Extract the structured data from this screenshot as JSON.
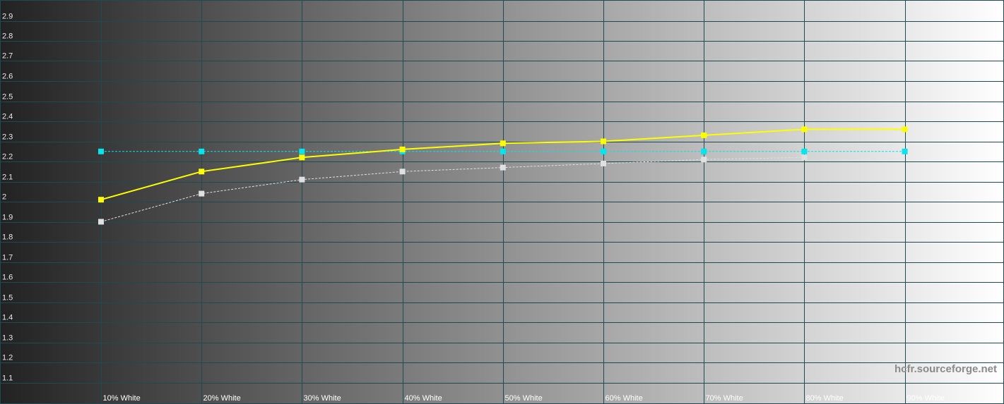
{
  "watermark": "hcfr.sourceforge.net",
  "colors": {
    "grid": "#1f4b50",
    "gradient_start": "#222222",
    "gradient_end": "#ffffff",
    "measured": "#ffff00",
    "reference": "#00e5ee",
    "previous": "#e0e0e0"
  },
  "chart_data": {
    "type": "line",
    "title": "",
    "xlabel": "",
    "ylabel": "",
    "categories": [
      "10% White",
      "20% White",
      "30% White",
      "40% White",
      "50% White",
      "60% White",
      "70% White",
      "80% White",
      "90% White"
    ],
    "y_ticks": [
      "2.9",
      "2.8",
      "2.7",
      "2.6",
      "2.5",
      "2.4",
      "2.3",
      "2.2",
      "2.1",
      "2",
      "1.9",
      "1.8",
      "1.7",
      "1.6",
      "1.5",
      "1.4",
      "1.3",
      "1.2",
      "1.1"
    ],
    "ylim": [
      1.0,
      3.0
    ],
    "grid": true,
    "legend": "none",
    "series": [
      {
        "key": "measured",
        "style": "solid",
        "values": [
          2.01,
          2.15,
          2.22,
          2.26,
          2.29,
          2.3,
          2.33,
          2.36,
          2.36
        ]
      },
      {
        "key": "reference",
        "style": "dotted",
        "values": [
          2.25,
          2.25,
          2.25,
          2.25,
          2.25,
          2.25,
          2.25,
          2.25,
          2.25
        ]
      },
      {
        "key": "previous",
        "style": "dotted",
        "values": [
          1.9,
          2.04,
          2.11,
          2.15,
          2.17,
          2.19,
          2.21,
          2.22,
          null
        ]
      }
    ]
  }
}
